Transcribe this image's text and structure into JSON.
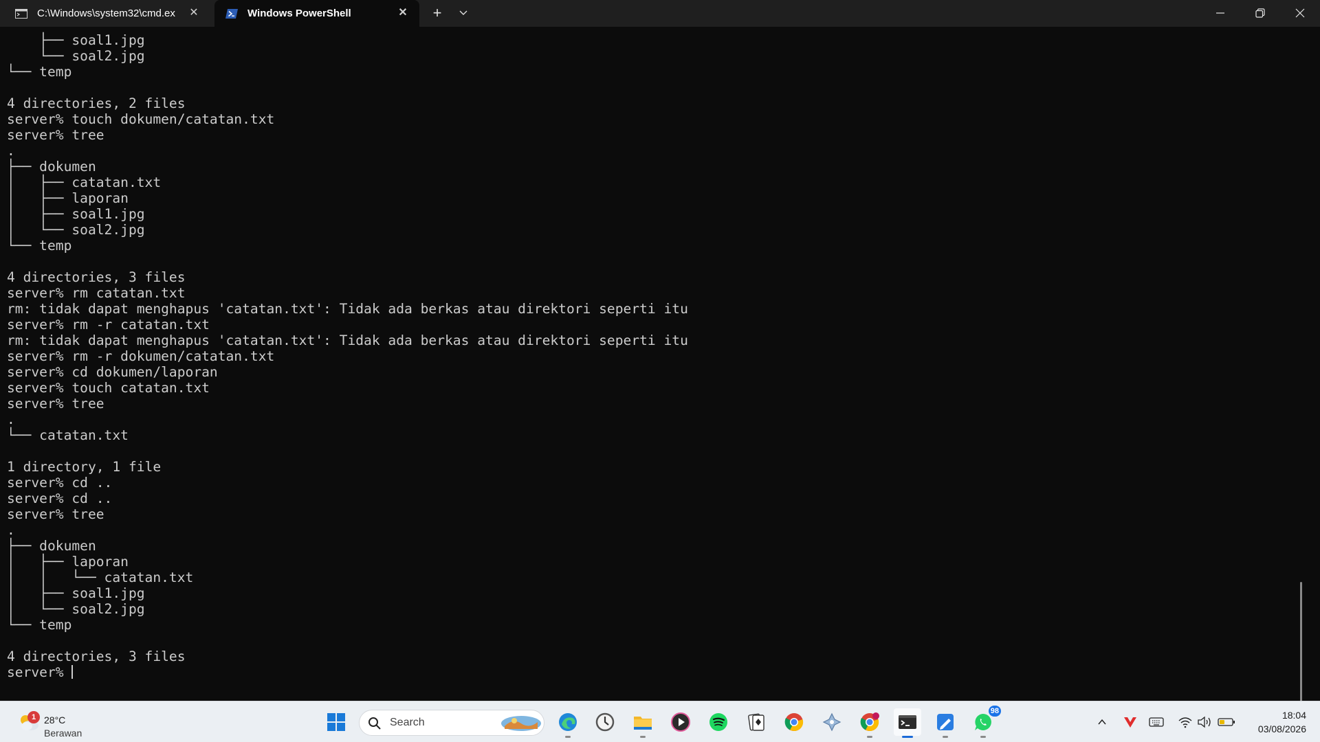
{
  "window": {
    "tabs": [
      {
        "label": "C:\\Windows\\system32\\cmd.ex",
        "icon": "cmd-icon",
        "active": false
      },
      {
        "label": "Windows PowerShell",
        "icon": "powershell-icon",
        "active": true
      }
    ],
    "new_tab_label": "+"
  },
  "terminal": {
    "lines": [
      "    ├── soal1.jpg",
      "    └── soal2.jpg",
      "└── temp",
      "",
      "4 directories, 2 files",
      "server% touch dokumen/catatan.txt",
      "server% tree",
      ".",
      "├── dokumen",
      "│   ├── catatan.txt",
      "│   ├── laporan",
      "│   ├── soal1.jpg",
      "│   └── soal2.jpg",
      "└── temp",
      "",
      "4 directories, 3 files",
      "server% rm catatan.txt",
      "rm: tidak dapat menghapus 'catatan.txt': Tidak ada berkas atau direktori seperti itu",
      "server% rm -r catatan.txt",
      "rm: tidak dapat menghapus 'catatan.txt': Tidak ada berkas atau direktori seperti itu",
      "server% rm -r dokumen/catatan.txt",
      "server% cd dokumen/laporan",
      "server% touch catatan.txt",
      "server% tree",
      ".",
      "└── catatan.txt",
      "",
      "1 directory, 1 file",
      "server% cd ..",
      "server% cd ..",
      "server% tree",
      ".",
      "├── dokumen",
      "│   ├── laporan",
      "│   │   └── catatan.txt",
      "│   ├── soal1.jpg",
      "│   └── soal2.jpg",
      "└── temp",
      "",
      "4 directories, 3 files",
      "server% "
    ]
  },
  "taskbar": {
    "weather": {
      "temp": "28°C",
      "desc": "Berawan",
      "badge": "1"
    },
    "search": {
      "placeholder": "Search"
    },
    "apps": [
      {
        "name": "start-icon"
      },
      {
        "name": "edge-icon"
      },
      {
        "name": "clock-app-icon"
      },
      {
        "name": "file-explorer-icon"
      },
      {
        "name": "media-player-icon"
      },
      {
        "name": "spotify-icon"
      },
      {
        "name": "solitaire-icon"
      },
      {
        "name": "chrome-icon"
      },
      {
        "name": "game-controller-icon"
      },
      {
        "name": "chrome-profile-icon"
      },
      {
        "name": "terminal-icon"
      },
      {
        "name": "whiteboard-icon"
      },
      {
        "name": "whatsapp-icon",
        "badge": "98"
      }
    ],
    "clock": {
      "time": "18:04",
      "date": "03/08/2026"
    }
  }
}
